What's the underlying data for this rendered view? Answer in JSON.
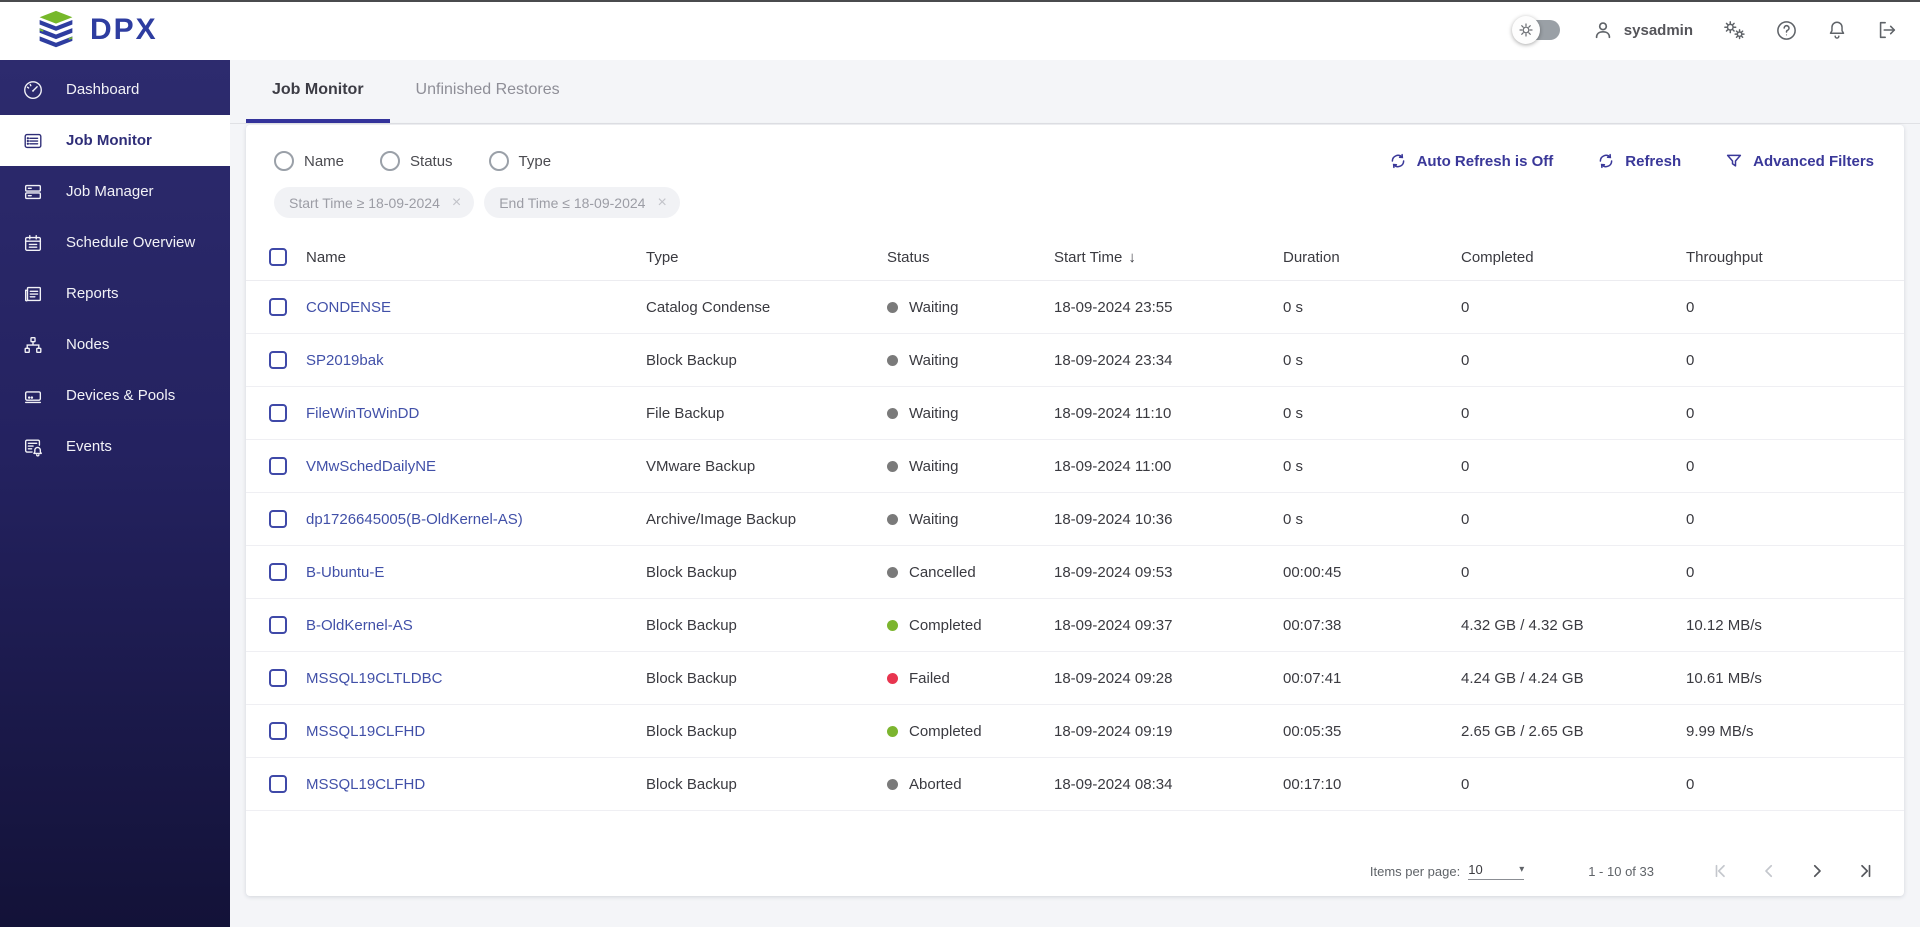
{
  "header": {
    "logo_text": "DPX",
    "user_name": "sysadmin"
  },
  "sidebar": {
    "items": [
      {
        "label": "Dashboard",
        "active": false
      },
      {
        "label": "Job Monitor",
        "active": true
      },
      {
        "label": "Job Manager",
        "active": false
      },
      {
        "label": "Schedule Overview",
        "active": false
      },
      {
        "label": "Reports",
        "active": false
      },
      {
        "label": "Nodes",
        "active": false
      },
      {
        "label": "Devices & Pools",
        "active": false
      },
      {
        "label": "Events",
        "active": false
      }
    ]
  },
  "tabs": [
    {
      "label": "Job Monitor",
      "active": true
    },
    {
      "label": "Unfinished Restores",
      "active": false
    }
  ],
  "filters": {
    "radios": [
      "Name",
      "Status",
      "Type"
    ],
    "chips": [
      {
        "text": "Start Time ≥  18-09-2024"
      },
      {
        "text": "End Time ≤  18-09-2024"
      }
    ]
  },
  "actions": {
    "auto_refresh": "Auto Refresh is Off",
    "refresh": "Refresh",
    "advanced_filters": "Advanced Filters"
  },
  "icons": {
    "close": "×",
    "sort_desc": "↓",
    "caret_down": "▾"
  },
  "table": {
    "columns": [
      "Name",
      "Type",
      "Status",
      "Start Time",
      "Duration",
      "Completed",
      "Throughput"
    ],
    "sorted_by": "Start Time",
    "sort_direction": "descending",
    "rows": [
      {
        "name": "CONDENSE",
        "type": "Catalog Condense",
        "status": "Waiting",
        "status_kind": "waiting",
        "start_time": "18-09-2024 23:55",
        "duration": "0 s",
        "completed": "0",
        "throughput": "0"
      },
      {
        "name": "SP2019bak",
        "type": "Block Backup",
        "status": "Waiting",
        "status_kind": "waiting",
        "start_time": "18-09-2024 23:34",
        "duration": "0 s",
        "completed": "0",
        "throughput": "0"
      },
      {
        "name": "FileWinToWinDD",
        "type": "File Backup",
        "status": "Waiting",
        "status_kind": "waiting",
        "start_time": "18-09-2024 11:10",
        "duration": "0 s",
        "completed": "0",
        "throughput": "0"
      },
      {
        "name": "VMwSchedDailyNE",
        "type": "VMware Backup",
        "status": "Waiting",
        "status_kind": "waiting",
        "start_time": "18-09-2024 11:00",
        "duration": "0 s",
        "completed": "0",
        "throughput": "0"
      },
      {
        "name": "dp1726645005(B-OldKernel-AS)",
        "type": "Archive/Image Backup",
        "status": "Waiting",
        "status_kind": "waiting",
        "start_time": "18-09-2024 10:36",
        "duration": "0 s",
        "completed": "0",
        "throughput": "0"
      },
      {
        "name": "B-Ubuntu-E",
        "type": "Block Backup",
        "status": "Cancelled",
        "status_kind": "cancelled",
        "start_time": "18-09-2024 09:53",
        "duration": "00:00:45",
        "completed": "0",
        "throughput": "0"
      },
      {
        "name": "B-OldKernel-AS",
        "type": "Block Backup",
        "status": "Completed",
        "status_kind": "completed",
        "start_time": "18-09-2024 09:37",
        "duration": "00:07:38",
        "completed": "4.32 GB / 4.32 GB",
        "throughput": "10.12 MB/s"
      },
      {
        "name": "MSSQL19CLTLDBC",
        "type": "Block Backup",
        "status": "Failed",
        "status_kind": "failed",
        "start_time": "18-09-2024 09:28",
        "duration": "00:07:41",
        "completed": "4.24 GB / 4.24 GB",
        "throughput": "10.61 MB/s"
      },
      {
        "name": "MSSQL19CLFHD",
        "type": "Block Backup",
        "status": "Completed",
        "status_kind": "completed",
        "start_time": "18-09-2024 09:19",
        "duration": "00:05:35",
        "completed": "2.65 GB / 2.65 GB",
        "throughput": "9.99 MB/s"
      },
      {
        "name": "MSSQL19CLFHD",
        "type": "Block Backup",
        "status": "Aborted",
        "status_kind": "aborted",
        "start_time": "18-09-2024 08:34",
        "duration": "00:17:10",
        "completed": "0",
        "throughput": "0"
      }
    ]
  },
  "pagination": {
    "items_per_page_label": "Items per page:",
    "items_per_page": "10",
    "range": "1 - 10 of 33"
  },
  "colors": {
    "accent": "#3A3899",
    "link": "#4150A8",
    "status_completed": "#7CB52F",
    "status_failed": "#E8354F",
    "status_neutral": "#7A7A7A",
    "sidebar_top": "#2D2B6E",
    "sidebar_bottom": "#131238"
  }
}
